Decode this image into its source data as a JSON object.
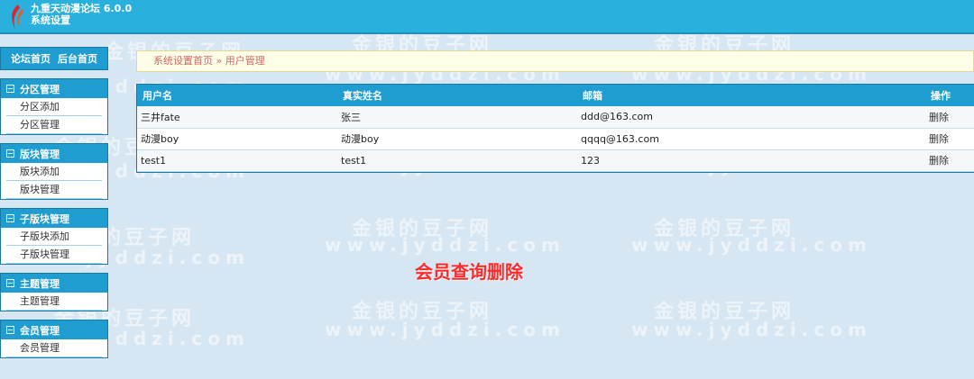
{
  "app": {
    "title_line1": "九重天动漫论坛 6.0.0",
    "title_line2": "系统设置"
  },
  "watermark": {
    "cn": "金银的豆子网",
    "en": "www.jyddzi.com"
  },
  "sidebar": {
    "nav": [
      "论坛首页",
      "后台首页"
    ],
    "groups": [
      {
        "title": "分区管理",
        "items": [
          "分区添加",
          "分区管理"
        ]
      },
      {
        "title": "版块管理",
        "items": [
          "版块添加",
          "版块管理"
        ]
      },
      {
        "title": "子版块管理",
        "items": [
          "子版块添加",
          "子版块管理"
        ]
      },
      {
        "title": "主题管理",
        "items": [
          "主题管理"
        ]
      },
      {
        "title": "会员管理",
        "items": [
          "会员管理"
        ]
      }
    ]
  },
  "breadcrumb": {
    "home": "系统设置首页",
    "sep": " » ",
    "current": "用户管理"
  },
  "table": {
    "headers": [
      "用户名",
      "真实姓名",
      "邮箱",
      "操作"
    ],
    "rows": [
      {
        "username": "三井fate",
        "realname": "张三",
        "email": "ddd@163.com",
        "action": "删除"
      },
      {
        "username": "动漫boy",
        "realname": "动漫boy",
        "email": "qqqq@163.com",
        "action": "删除"
      },
      {
        "username": "test1",
        "realname": "test1",
        "email": "123",
        "action": "删除"
      }
    ]
  },
  "caption": "会员查询删除",
  "colors": {
    "header": "#2ab0dd",
    "accent": "#1f9cd0",
    "caption": "#ff2a2a",
    "background": "#d6e6f2"
  }
}
